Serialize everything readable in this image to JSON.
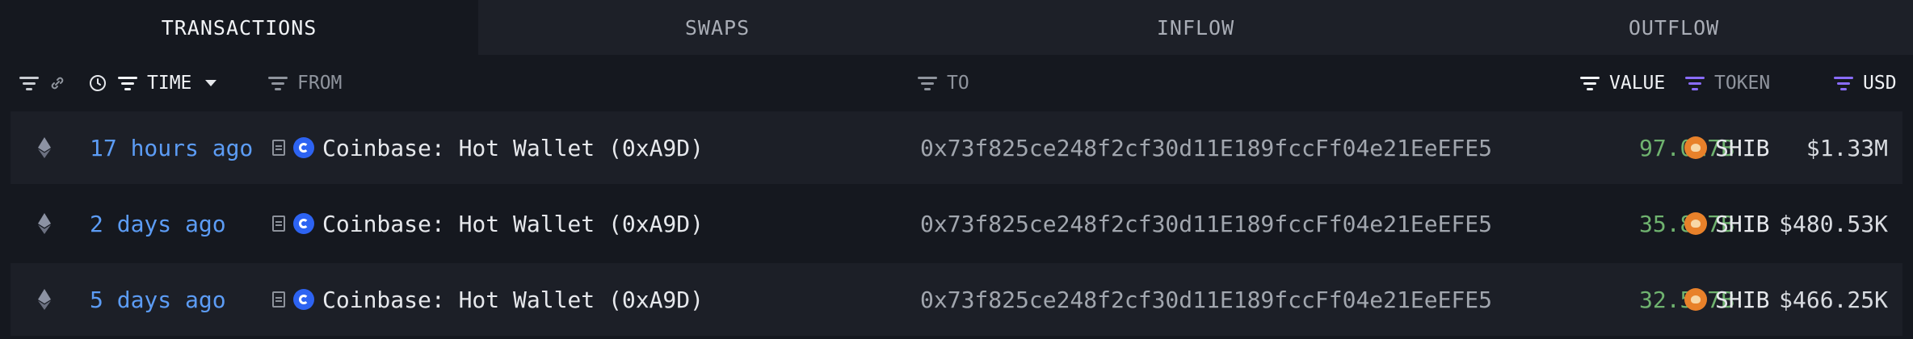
{
  "tabs": [
    "TRANSACTIONS",
    "SWAPS",
    "INFLOW",
    "OUTFLOW"
  ],
  "columns": {
    "time": "TIME",
    "from": "FROM",
    "to": "TO",
    "value": "VALUE",
    "token": "TOKEN",
    "usd": "USD"
  },
  "rows": [
    {
      "time": "17 hours ago",
      "from": "Coinbase: Hot Wallet (0xA9D)",
      "to": "0x73f825ce248f2cf30d11E189fccFf04e21EeEFE5",
      "value": "97.027B",
      "token": "SHIB",
      "usd": "$1.33M"
    },
    {
      "time": "2 days ago",
      "from": "Coinbase: Hot Wallet (0xA9D)",
      "to": "0x73f825ce248f2cf30d11E189fccFf04e21EeEFE5",
      "value": "35.807B",
      "token": "SHIB",
      "usd": "$480.53K"
    },
    {
      "time": "5 days ago",
      "from": "Coinbase: Hot Wallet (0xA9D)",
      "to": "0x73f825ce248f2cf30d11E189fccFf04e21EeEFE5",
      "value": "32.537B",
      "token": "SHIB",
      "usd": "$466.25K"
    }
  ],
  "colors": {
    "time": "#5c9cf5",
    "value": "#6fb36f",
    "accent": "#8a6cff"
  }
}
